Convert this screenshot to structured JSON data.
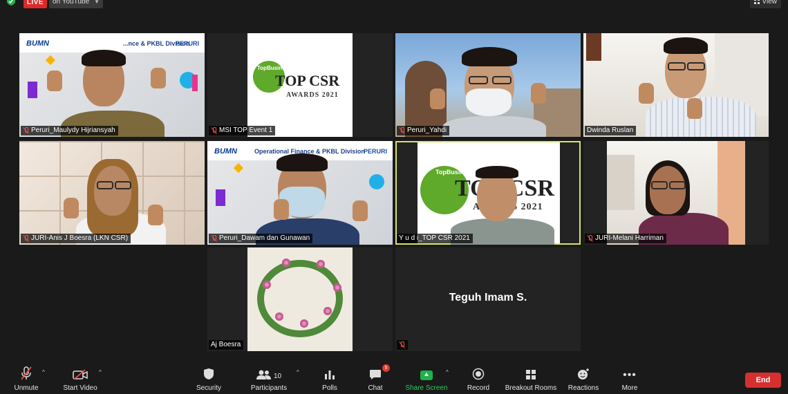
{
  "top_bar": {
    "live_label": "LIVE",
    "stream_target": "on YouTube",
    "view_label": "View"
  },
  "tiles": [
    {
      "name": "Peruri_Maulydy Hijriansyah",
      "muted": true,
      "banner": "...nce & PKBL Division"
    },
    {
      "name": "MSI TOP Event 1",
      "muted": true
    },
    {
      "name": "Peruri_Yahdi",
      "muted": true
    },
    {
      "name": "Dwinda Ruslan",
      "muted": false
    },
    {
      "name": "JURI-Anis J Boesra (LKN CSR)",
      "muted": true
    },
    {
      "name": "Peruri_Dawam dan Gunawan",
      "muted": true,
      "banner": "Operational Finance & PKBL Division"
    },
    {
      "name": "Y u d i_TOP CSR 2021",
      "muted": false,
      "active_speaker": true
    },
    {
      "name": "JURI-Melani Harriman",
      "muted": true
    },
    {
      "name": "Aj Boesra",
      "muted": false
    },
    {
      "name": "",
      "display_name": "Teguh Imam S.",
      "muted": true
    }
  ],
  "logos": {
    "bumn": "BUMN",
    "peruri": "PERURI",
    "top_business": "TopBusiness",
    "top_csr": "TOP CSR",
    "awards": "AWARDS 2021"
  },
  "toolbar": {
    "unmute": "Unmute",
    "start_video": "Start Video",
    "security": "Security",
    "participants": "Participants",
    "participants_count": "10",
    "polls": "Polls",
    "chat": "Chat",
    "chat_badge": "5",
    "share_screen": "Share Screen",
    "record": "Record",
    "breakout_rooms": "Breakout Rooms",
    "reactions": "Reactions",
    "more": "More",
    "end": "End"
  },
  "colors": {
    "background": "#1a1a1a",
    "live": "#e02828",
    "active_speaker_border": "#d8e36a",
    "share_green": "#1fb24a",
    "end_red": "#d62f2f",
    "csr_green": "#5fa92b"
  }
}
